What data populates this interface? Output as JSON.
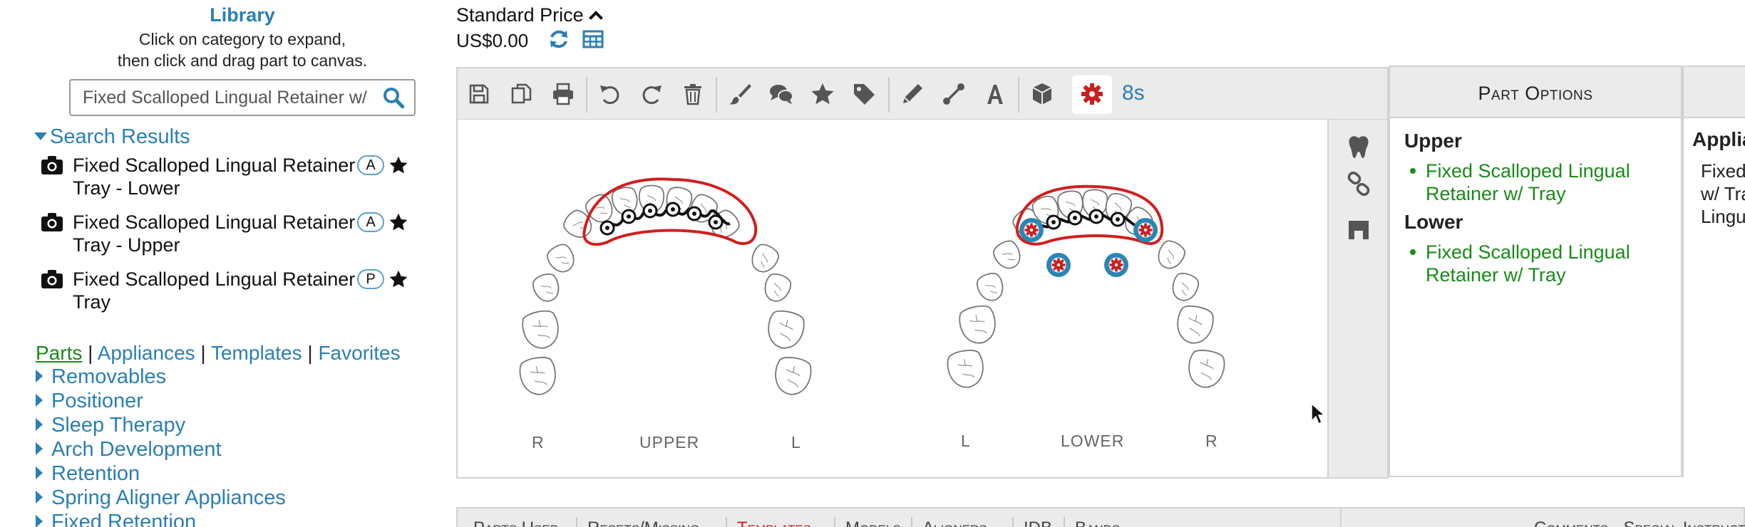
{
  "library": {
    "title": "Library",
    "instruction_line1": "Click on category to expand,",
    "instruction_line2": "then click and drag part to canvas.",
    "search_value": "Fixed Scalloped Lingual Retainer w/",
    "search_results_label": "Search Results",
    "results": [
      {
        "name": "Fixed Scalloped Lingual Retainer w/ Tray - Lower",
        "badge": "A"
      },
      {
        "name": "Fixed Scalloped Lingual Retainer w/ Tray - Upper",
        "badge": "A"
      },
      {
        "name": "Fixed Scalloped Lingual Retainer w/ Tray",
        "badge": "P"
      }
    ],
    "links": [
      "Parts",
      "Appliances",
      "Templates",
      "Favorites"
    ],
    "link_separator": "|",
    "categories": [
      "Removables",
      "Positioner",
      "Sleep Therapy",
      "Arch Development",
      "Retention",
      "Spring Aligner Appliances",
      "Fixed Retention"
    ]
  },
  "price": {
    "label": "Standard Price",
    "value": "US$0.00"
  },
  "toolbar": {
    "timer": "8s"
  },
  "canvas": {
    "upper_label": "UPPER",
    "lower_label": "LOWER",
    "upper_left": "R",
    "upper_right": "L",
    "lower_left": "L",
    "lower_right": "R"
  },
  "part_options": {
    "title": "Part Options",
    "upper_heading": "Upper",
    "upper_item": "Fixed Scalloped Lingual Retainer w/ Tray",
    "lower_heading": "Lower",
    "lower_item": "Fixed Scalloped Lingual Retainer w/ Tray"
  },
  "appliance_panel": {
    "title": "Appliance",
    "line1": "Fixed Scalloped",
    "line2": "w/ Tray",
    "line3": "Lingual"
  },
  "bottom_tabs": [
    "Parts Used",
    "Resets/Missing",
    "Templates",
    "Models",
    "Aligners",
    "IDB",
    "Bands"
  ],
  "bottom_right_label": "Comments - Special Instructions",
  "colors": {
    "accent": "#2a7fb3",
    "green": "#1a8a1a",
    "red": "#c92020",
    "retainer_outline": "#d01f1f",
    "band": "#2a86b5"
  }
}
